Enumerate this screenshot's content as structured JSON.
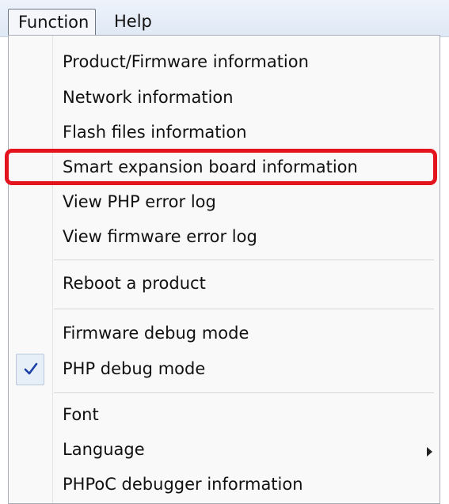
{
  "menubar": {
    "function_label": "Function",
    "help_label": "Help"
  },
  "menu": {
    "items": [
      {
        "label": "Product/Firmware information"
      },
      {
        "label": "Network information"
      },
      {
        "label": "Flash files information"
      },
      {
        "label": "Smart expansion board information"
      },
      {
        "label": "View PHP error log"
      },
      {
        "label": "View firmware error log"
      },
      {
        "label": "Reboot a product"
      },
      {
        "label": "Firmware debug mode"
      },
      {
        "label": "PHP debug mode",
        "checked": true
      },
      {
        "label": "Font"
      },
      {
        "label": "Language",
        "submenu": true
      },
      {
        "label": "PHPoC debugger information"
      }
    ]
  },
  "icons": {
    "check": "checkmark-icon",
    "submenu": "submenu-arrow-icon"
  },
  "colors": {
    "highlight": "#e3141e",
    "check": "#1a3fa6",
    "menu_background": "#f9f9f9"
  }
}
